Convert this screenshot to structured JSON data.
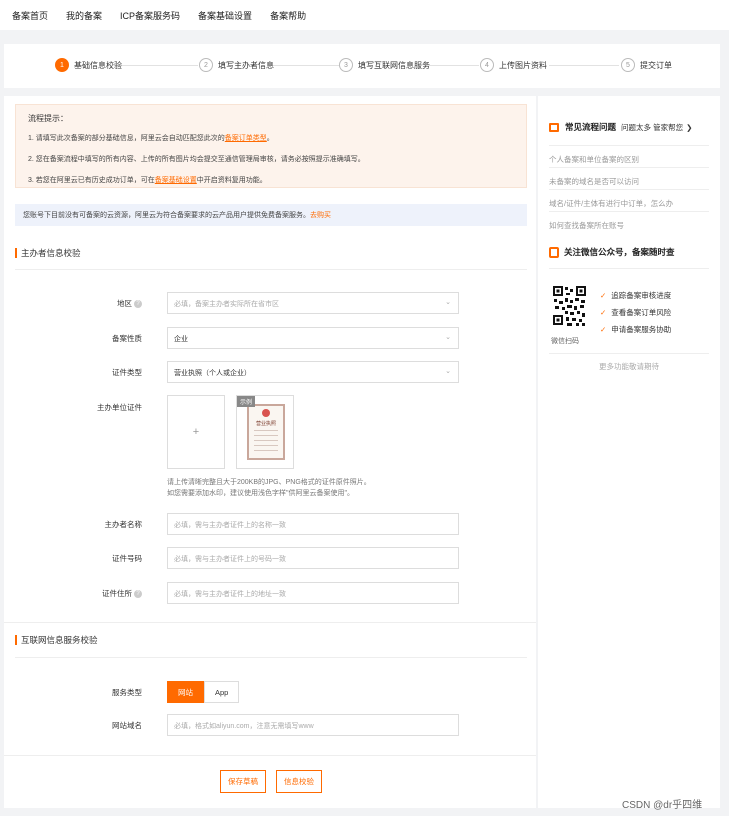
{
  "topnav": {
    "items": [
      "备案首页",
      "我的备案",
      "ICP备案服务码",
      "备案基础设置",
      "备案帮助"
    ]
  },
  "steps": [
    {
      "num": "1",
      "label": "基础信息校验",
      "active": true
    },
    {
      "num": "2",
      "label": "填写主办者信息",
      "active": false
    },
    {
      "num": "3",
      "label": "填写互联网信息服务",
      "active": false
    },
    {
      "num": "4",
      "label": "上传图片资料",
      "active": false
    },
    {
      "num": "5",
      "label": "提交订单",
      "active": false
    }
  ],
  "tips": {
    "title": "流程提示：",
    "line1_pre": "1. 请填写此次备案的部分基础信息，阿里云会自动匹配您此次的",
    "line1_link": "备案订单类型",
    "line1_post": "。",
    "line2": "2. 您在备案流程中填写的所有内容、上传的所有图片均会提交至通信管理局审核，请务必按照提示准确填写。",
    "line3_pre": "3. 若您在阿里云已有历史成功订单，可在",
    "line3_link": "备案基础设置",
    "line3_post": "中开启资料复用功能。"
  },
  "notice": {
    "text": "您账号下目前没有可备案的云资源，阿里云为符合备案要求的云产品用户提供免费备案服务。",
    "link": "去购买"
  },
  "sponsor": {
    "title": "主办者信息校验",
    "region_label": "地区",
    "region_placeholder": "必填，备案主办者实际所在省市区",
    "nature_label": "备案性质",
    "nature_value": "企业",
    "cert_type_label": "证件类型",
    "cert_type_value": "营业执照（个人或企业）",
    "cert_label": "主办单位证件",
    "upload_plus": "+",
    "sample_tag": "示例",
    "sample_doc_title": "营业执照",
    "hint_line1": "请上传清晰完整且大于200KB的JPG、PNG格式的证件原件照片。",
    "hint_line2": "如您需要添加水印，建议使用浅色字样\"供阿里云备案使用\"。",
    "name_label": "主办者名称",
    "name_placeholder": "必填，需与主办者证件上的名称一致",
    "cert_no_label": "证件号码",
    "cert_no_placeholder": "必填，需与主办者证件上的号码一致",
    "address_label": "证件住所",
    "address_placeholder": "必填，需与主办者证件上的地址一致",
    "help": "?"
  },
  "internet": {
    "title": "互联网信息服务校验",
    "service_type_label": "服务类型",
    "service_types": [
      "网站",
      "App"
    ],
    "domain_label": "网站域名",
    "domain_placeholder": "必填，格式如aliyun.com，注意无需填写www"
  },
  "actions": {
    "save_draft": "保存草稿",
    "verify": "信息校验"
  },
  "sidebar": {
    "faq_title": "常见流程问题",
    "faq_sub": "问题太多 管家帮您",
    "faq_arrow": "❯",
    "faq_items": [
      "个人备案和单位备案的区别",
      "未备案的域名是否可以访问",
      "域名/证件/主体有进行中订单，怎么办",
      "如何查找备案所在账号"
    ],
    "wechat_title": "关注微信公众号，备案随时查",
    "qr_caption": "微信扫码",
    "benefits": [
      "追踪备案审核进度",
      "查看备案订单风险",
      "申请备案服务协助"
    ],
    "check": "✓",
    "more": "更多功能敬请期待"
  },
  "watermark": "CSDN @dr乎四维",
  "colors": {
    "accent": "#ff6a00",
    "tips_bg": "#fdf3ec",
    "notice_bg": "#eef2fb"
  }
}
